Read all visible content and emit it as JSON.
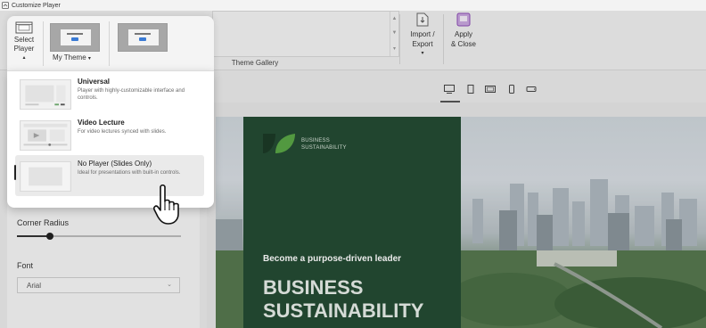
{
  "window": {
    "title": "Customize Player"
  },
  "ribbon": {
    "select_player": {
      "line1": "Select",
      "line2": "Player"
    },
    "my_theme": "My Theme",
    "theme_gallery": "Theme Gallery",
    "import_export": {
      "line1": "Import /",
      "line2": "Export"
    },
    "apply_close": {
      "line1": "Apply",
      "line2": "& Close"
    }
  },
  "player_menu": {
    "items": [
      {
        "title": "Universal",
        "description": "Player with highly-customizable interface and controls."
      },
      {
        "title": "Video Lecture",
        "description": "For video lectures synced with slides."
      },
      {
        "title": "No Player (Slides Only)",
        "description": "Ideal for presentations with built-in controls."
      }
    ],
    "selected_index": 2
  },
  "settings_panel": {
    "corner_radius_label": "Corner Radius",
    "corner_radius_value": 0.2,
    "font_label": "Font",
    "font_value": "Arial"
  },
  "preview": {
    "devices": [
      "desktop-icon",
      "tablet-portrait-icon",
      "tablet-landscape-icon",
      "phone-portrait-icon",
      "phone-landscape-icon"
    ],
    "active_device": 0,
    "slide": {
      "brand_line1": "BUSINESS",
      "brand_line2": "SUSTAINABILITY",
      "tagline": "Become a purpose-driven leader",
      "title_line1": "BUSINESS",
      "title_line2": "SUSTAINABILITY"
    }
  },
  "colors": {
    "slide_green": "#244b33",
    "accent_green": "#3e8e41",
    "apply_purple": "#8c4bb5"
  }
}
